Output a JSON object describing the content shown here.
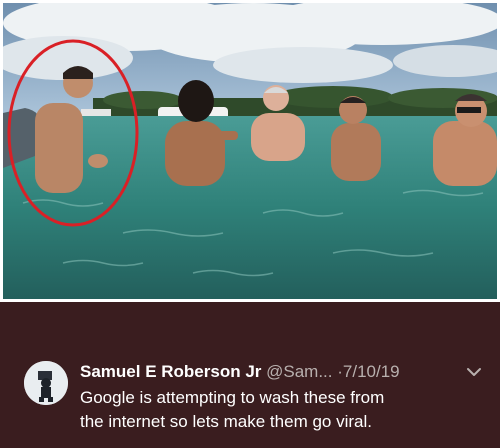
{
  "photo": {
    "icon": "beach-photo",
    "highlight_color": "#d92026"
  },
  "tweet": {
    "display_name": "Samuel E Roberson Jr",
    "handle": "@Sam...",
    "separator": "·",
    "date": "7/10/19",
    "text_line_1": "Google is attempting to wash these from",
    "text_line_2": "the internet so lets make them go viral.",
    "avatar_icon": "avatar-silhouette",
    "menu_icon": "chevron-down-icon",
    "background_color": "#3a1d1f"
  }
}
